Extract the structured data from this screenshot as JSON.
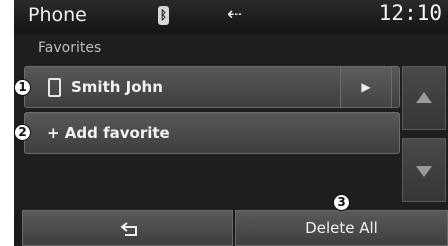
{
  "status_bar": {
    "title": "Phone",
    "bluetooth_icon": "bluetooth-icon",
    "usb_icon": "usb-icon",
    "clock": "12:10"
  },
  "screen": {
    "subtitle": "Favorites"
  },
  "favorites": [
    {
      "label": "Smith John",
      "icon": "phone-icon",
      "action_icon": "play-arrow-icon"
    },
    {
      "label": "+ Add favorite"
    }
  ],
  "scroll": {
    "up_icon": "arrow-up-icon",
    "down_icon": "arrow-down-icon"
  },
  "bottom_bar": {
    "back_icon": "back-icon",
    "delete_all_label": "Delete All"
  },
  "callouts": [
    "1",
    "2",
    "3"
  ],
  "colors": {
    "background": "#1e1e1e",
    "button": "#4a4a4a",
    "text": "#f2f2f2"
  }
}
